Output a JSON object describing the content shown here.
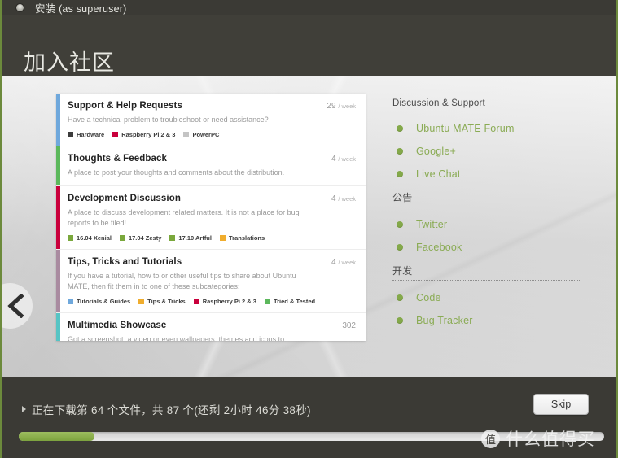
{
  "window": {
    "icon": "window-menu-icon",
    "title": "安装 (as superuser)"
  },
  "banner": {
    "title": "加入社区"
  },
  "forum": {
    "categories": [
      {
        "accent": "#6fa8dc",
        "title": "Support & Help Requests",
        "count": "29",
        "per": "/ week",
        "desc": "Have a technical problem to troubleshoot or need assistance?",
        "tags": [
          {
            "label": "Hardware",
            "color": "#3c3c3c"
          },
          {
            "label": "Raspberry Pi 2 & 3",
            "color": "#c9003c"
          },
          {
            "label": "PowerPC",
            "color": "#c4c4c4"
          }
        ]
      },
      {
        "accent": "#5cb85c",
        "title": "Thoughts & Feedback",
        "count": "4",
        "per": "/ week",
        "desc": "A place to post your thoughts and comments about the distribution.",
        "tags": []
      },
      {
        "accent": "#c9003c",
        "title": "Development Discussion",
        "count": "4",
        "per": "/ week",
        "desc": "A place to discuss development related matters. It is not a place for bug reports to be filed!",
        "tags": [
          {
            "label": "16.04 Xenial",
            "color": "#7aa83c"
          },
          {
            "label": "17.04 Zesty",
            "color": "#7aa83c"
          },
          {
            "label": "17.10 Artful",
            "color": "#7aa83c"
          },
          {
            "label": "Translations",
            "color": "#f0ad2e"
          }
        ]
      },
      {
        "accent": "#a98ba0",
        "title": "Tips, Tricks and Tutorials",
        "count": "4",
        "per": "/ week",
        "desc": "If you have a tutorial, how to or other useful tips to share about Ubuntu MATE, then fit them in to one of these subcategories:",
        "tags": [
          {
            "label": "Tutorials & Guides",
            "color": "#6fa8dc"
          },
          {
            "label": "Tips & Tricks",
            "color": "#f0ad2e"
          },
          {
            "label": "Raspberry Pi 2 & 3",
            "color": "#c9003c"
          },
          {
            "label": "Tried & Tested",
            "color": "#5cb85c"
          }
        ]
      },
      {
        "accent": "#56c4c4",
        "title": "Multimedia Showcase",
        "count": "302",
        "per": "",
        "desc": "Got a screenshot, a video or even wallpapers, themes and icons to",
        "tags": []
      }
    ]
  },
  "sidebar": {
    "groups": [
      {
        "heading": "Discussion & Support",
        "links": [
          {
            "label": "Ubuntu MATE Forum"
          },
          {
            "label": "Google+"
          },
          {
            "label": "Live Chat"
          }
        ]
      },
      {
        "heading": "公告",
        "links": [
          {
            "label": "Twitter"
          },
          {
            "label": "Facebook"
          }
        ]
      },
      {
        "heading": "开发",
        "links": [
          {
            "label": "Code"
          },
          {
            "label": "Bug Tracker"
          }
        ]
      }
    ],
    "logo_icon": "ubuntu-mate-logo-icon"
  },
  "navigation": {
    "prev_icon": "chevron-left-icon"
  },
  "footer": {
    "status": "正在下载第 64 个文件，共 87 个(还剩 2小时 46分 38秒)",
    "skip_label": "Skip",
    "progress_percent": 13
  },
  "watermark": {
    "badge": "值",
    "text": "什么值得买"
  },
  "colors": {
    "accent_green": "#8aab54",
    "dark_chrome": "#3b3a35",
    "border_green": "#6c8a3c"
  }
}
